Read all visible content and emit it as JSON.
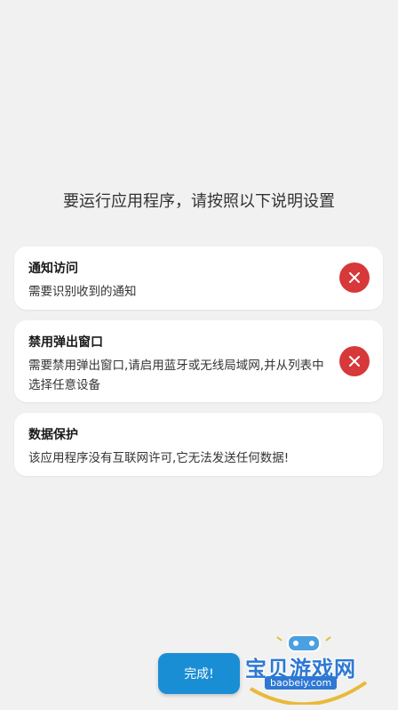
{
  "heading": "要运行应用程序，请按照以下说明设置",
  "cards": [
    {
      "title": "通知访问",
      "description": "需要识别收到的通知",
      "status_icon": "close-icon"
    },
    {
      "title": "禁用弹出窗口",
      "description": "需要禁用弹出窗口,请启用蓝牙或无线局域网,并从列表中选择任意设备",
      "status_icon": "close-icon"
    },
    {
      "title": "数据保护",
      "description": "该应用程序没有互联网许可,它无法发送任何数据!"
    }
  ],
  "done_button": "完成!",
  "watermark": {
    "title": "宝贝游戏网",
    "url": "baobeiy.com"
  },
  "colors": {
    "background": "#f1f1f1",
    "error": "#d7383a",
    "accent": "#1a8ed4"
  }
}
